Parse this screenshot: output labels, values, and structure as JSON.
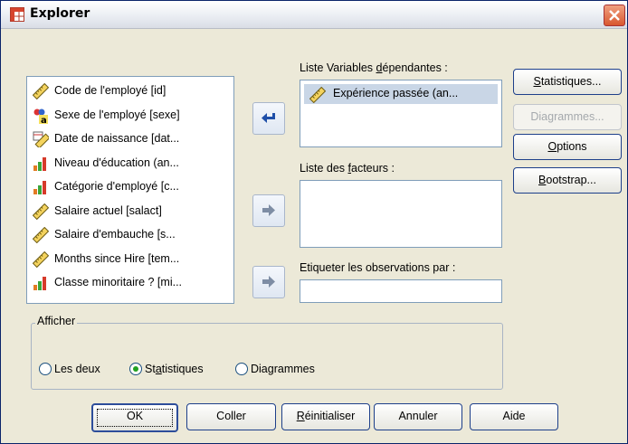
{
  "window": {
    "title": "Explorer",
    "close_icon": "close-icon",
    "accent": "#0a246a"
  },
  "variables": [
    {
      "label": "Code de l'employé [id]",
      "icon": "ruler-icon"
    },
    {
      "label": "Sexe de l'employé [sexe]",
      "icon": "nominal-a-icon"
    },
    {
      "label": "Date de naissance [dat...",
      "icon": "date-ruler-icon"
    },
    {
      "label": "Niveau d'éducation (an...",
      "icon": "ordinal-bars-icon"
    },
    {
      "label": "Catégorie d'employé [c...",
      "icon": "ordinal-bars-icon"
    },
    {
      "label": "Salaire actuel [salact]",
      "icon": "ruler-icon"
    },
    {
      "label": "Salaire d'embauche [s...",
      "icon": "ruler-icon"
    },
    {
      "label": "Months since Hire [tem...",
      "icon": "ruler-icon"
    },
    {
      "label": "Classe minoritaire ? [mi...",
      "icon": "ordinal-bars-icon"
    }
  ],
  "dependent": {
    "label_pre": "Liste Variables ",
    "label_u": "d",
    "label_post": "épendantes :",
    "items": [
      {
        "label": "Expérience passée (an...",
        "icon": "ruler-icon"
      }
    ]
  },
  "factors": {
    "label_pre": "Liste des ",
    "label_u": "f",
    "label_post": "acteurs :"
  },
  "label_cases": {
    "label": "Etiqueter les observations par :",
    "value": ""
  },
  "side_buttons": {
    "statistics_u": "S",
    "statistics_rest": "tatistiques...",
    "plots": "Diagrammes...",
    "options_u": "O",
    "options_rest": "ptions",
    "bootstrap_u": "B",
    "bootstrap_rest": "ootstrap..."
  },
  "display": {
    "title": "Afficher",
    "both": "Les deux",
    "stats_pre": "St",
    "stats_u": "a",
    "stats_post": "tistiques",
    "plots": "Diagrammes",
    "selected": "stats"
  },
  "bottom_buttons": {
    "ok": "OK",
    "paste": "Coller",
    "reset_u": "R",
    "reset_rest": "éinitialiser",
    "cancel": "Annuler",
    "help": "Aide"
  }
}
